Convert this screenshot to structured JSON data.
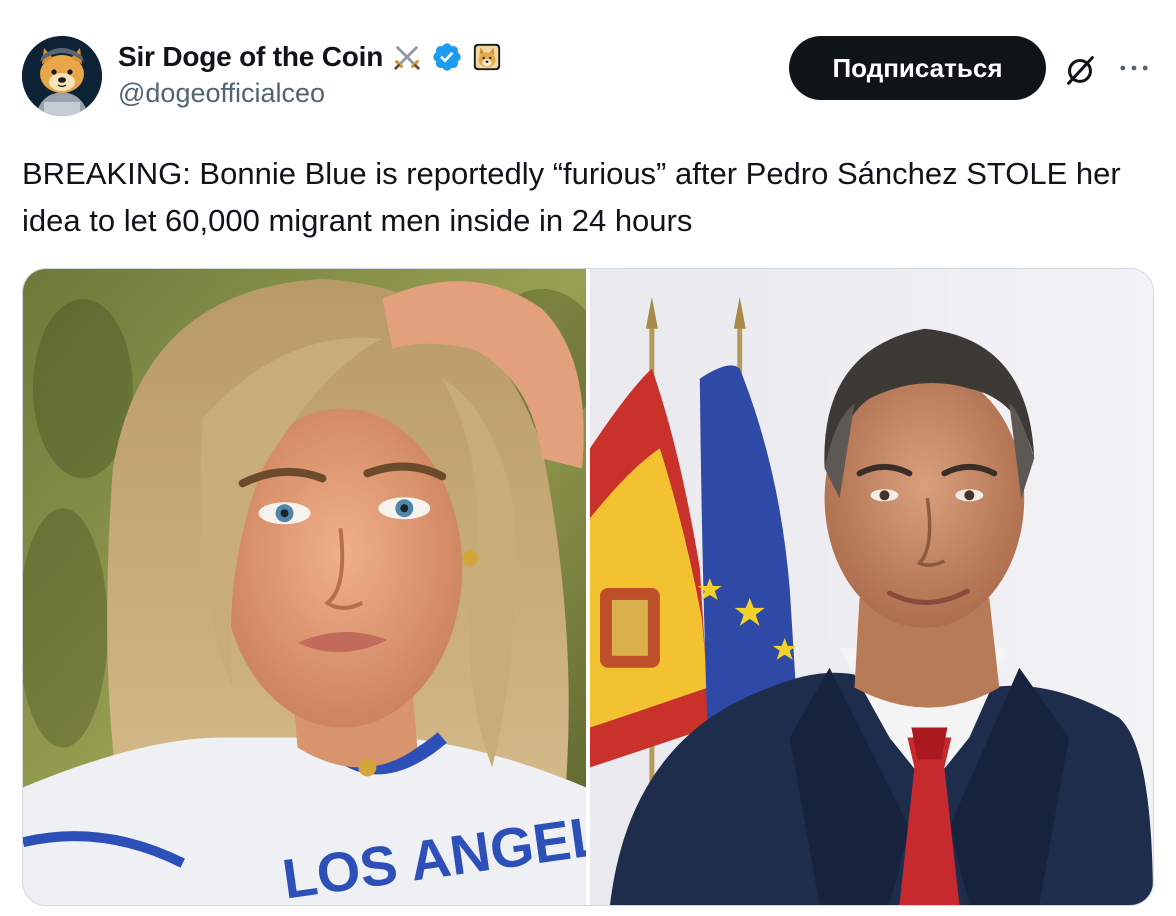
{
  "author": {
    "display_name": "Sir Doge of the Coin",
    "handle": "@dogeofficialceo",
    "name_emoji": "⚔️",
    "verified": true,
    "affiliate_icon": "doge-affiliate-icon"
  },
  "actions": {
    "follow_label": "Подписаться",
    "grok_icon": "grok-icon",
    "more_icon": "more-icon"
  },
  "tweet": {
    "text": "BREAKING: Bonnie Blue is reportedly “furious” after Pedro Sánchez STOLE her idea to let 60,000 migrant men inside in 24 hours"
  },
  "media": {
    "photos": [
      {
        "alt": "woman-selfie-photo",
        "shirt_text": "LOS ANGELES"
      },
      {
        "alt": "man-portrait-flags-photo"
      }
    ]
  },
  "colors": {
    "verified_blue": "#1d9bf0",
    "button_dark": "#0f1419",
    "secondary_text": "#536471",
    "border": "#cfd9de"
  }
}
